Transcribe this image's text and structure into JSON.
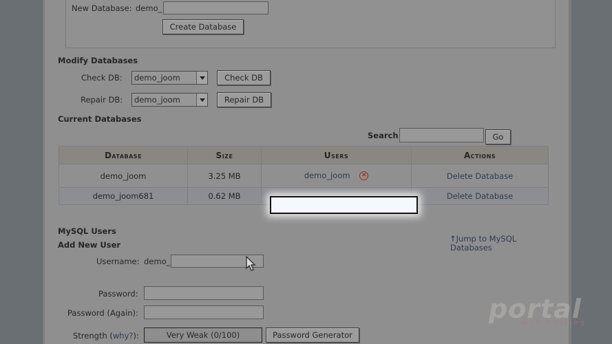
{
  "new_database": {
    "label": "New Database:",
    "prefix": "demo_",
    "value": "",
    "button": "Create Database"
  },
  "modify": {
    "heading": "Modify Databases",
    "check": {
      "label": "Check DB:",
      "selected": "demo_joom",
      "button": "Check DB"
    },
    "repair": {
      "label": "Repair DB:",
      "selected": "demo_joom",
      "button": "Repair DB"
    }
  },
  "current": {
    "heading": "Current Databases",
    "search_label": "Search",
    "search_value": "",
    "go_button": "Go",
    "columns": [
      "Database",
      "Size",
      "Users",
      "Actions"
    ],
    "rows": [
      {
        "database": "demo_joom",
        "size": "3.25 MB",
        "user": "demo_joom",
        "action": "Delete Database"
      },
      {
        "database": "demo_joom681",
        "size": "0.62 MB",
        "user": "",
        "action": "Delete Database"
      }
    ]
  },
  "mysql_users": {
    "heading": "MySQL Users",
    "subheading": "Add New User",
    "jump_link_line1": "Jump to MySQL",
    "jump_link_line2": "Databases",
    "username_label": "Username:",
    "username_prefix": "demo_",
    "username_value": "",
    "password_label": "Password:",
    "password_again_label": "Password (Again):",
    "strength_label": "Strength",
    "strength_help": "why?",
    "strength_value": "Very Weak (0/100)",
    "generator_button": "Password Generator"
  },
  "watermark": {
    "line1": "portal",
    "line2": "web hosting"
  },
  "colors": {
    "highlight_fill": "#f6f8ff",
    "delete_icon": "#a3887f"
  }
}
